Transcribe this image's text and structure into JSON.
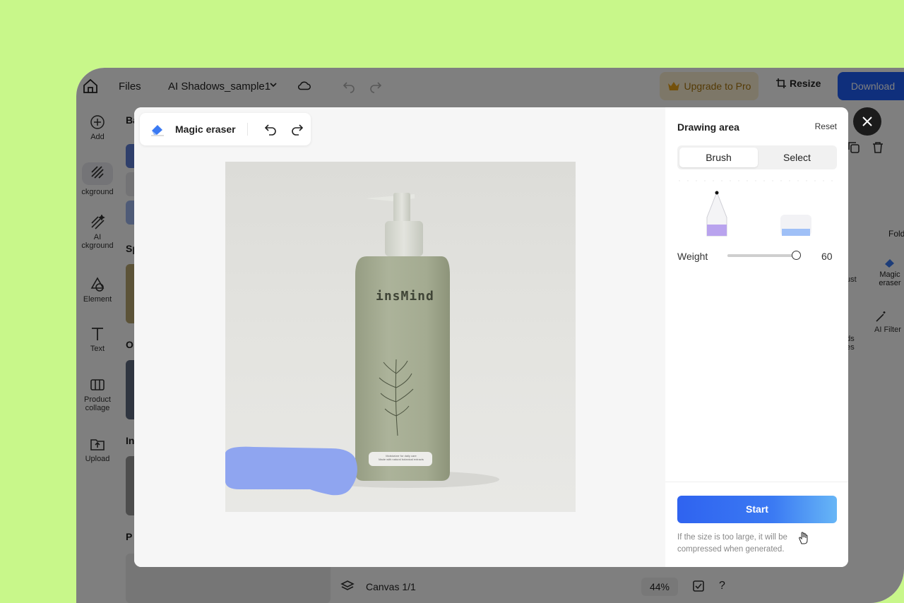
{
  "topbar": {
    "files_label": "Files",
    "doc_name": "AI Shadows_sample1",
    "upgrade_label": "Upgrade to Pro",
    "resize_label": "Resize",
    "download_label": "Download"
  },
  "rail": {
    "items": [
      {
        "label": "Add"
      },
      {
        "label": "ckground"
      },
      {
        "label": "AI",
        "label2": "ckground"
      },
      {
        "label": "Element"
      },
      {
        "label": "Text"
      },
      {
        "label": "Product",
        "label2": "collage"
      },
      {
        "label": "Upload"
      }
    ]
  },
  "left_panel": {
    "headings": [
      "Ba",
      "Sp",
      "O",
      "In",
      "P"
    ]
  },
  "right_panel": {
    "fold": "Fold",
    "items": [
      {
        "label": "ust"
      },
      {
        "label": "Magic",
        "label2": "eraser"
      },
      {
        "label": "nds",
        "label2": "ges"
      },
      {
        "label": "AI Filter"
      }
    ]
  },
  "bottombar": {
    "canvas_label": "Canvas 1/1",
    "zoom": "44%"
  },
  "modal": {
    "tool_title": "Magic eraser",
    "photo": {
      "brand": "insMind",
      "label_line1": "Moisturizer for daily care",
      "label_line2": "Made with natural botanical extracts"
    },
    "side": {
      "header": "Drawing area",
      "reset_label": "Reset",
      "tabs": [
        {
          "label": "Brush",
          "selected": true
        },
        {
          "label": "Select",
          "selected": false
        }
      ],
      "weight_label": "Weight",
      "weight_value": "60",
      "weight_fraction": 0.97,
      "start_label": "Start",
      "note": "If the size is too large, it will be compressed when generated."
    }
  },
  "colors": {
    "background_green": "#c8f78a",
    "accent_blue": "#1f5ef8",
    "brush_mask": "#8fa5f0",
    "bottle": "#a6ad93"
  }
}
